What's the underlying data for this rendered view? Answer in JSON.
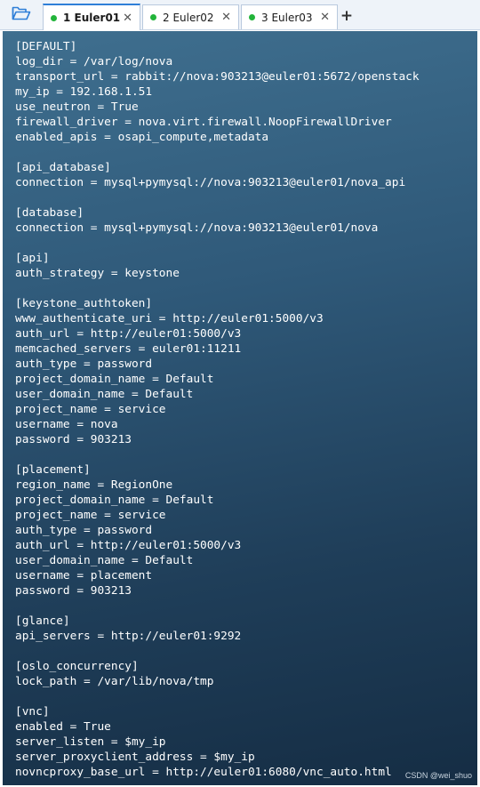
{
  "toolbar": {
    "folder_icon": "folder-open-icon"
  },
  "tabs": [
    {
      "label": "1 Euler01",
      "active": true,
      "status_color": "#22b43a"
    },
    {
      "label": "2 Euler02",
      "active": false,
      "status_color": "#22b43a"
    },
    {
      "label": "3 Euler03",
      "active": false,
      "status_color": "#22b43a"
    }
  ],
  "tab_close_glyph": "✕",
  "add_tab_glyph": "+",
  "terminal": {
    "lines": [
      "[DEFAULT]",
      "log_dir = /var/log/nova",
      "transport_url = rabbit://nova:903213@euler01:5672/openstack",
      "my_ip = 192.168.1.51",
      "use_neutron = True",
      "firewall_driver = nova.virt.firewall.NoopFirewallDriver",
      "enabled_apis = osapi_compute,metadata",
      "",
      "[api_database]",
      "connection = mysql+pymysql://nova:903213@euler01/nova_api",
      "",
      "[database]",
      "connection = mysql+pymysql://nova:903213@euler01/nova",
      "",
      "[api]",
      "auth_strategy = keystone",
      "",
      "[keystone_authtoken]",
      "www_authenticate_uri = http://euler01:5000/v3",
      "auth_url = http://euler01:5000/v3",
      "memcached_servers = euler01:11211",
      "auth_type = password",
      "project_domain_name = Default",
      "user_domain_name = Default",
      "project_name = service",
      "username = nova",
      "password = 903213",
      "",
      "[placement]",
      "region_name = RegionOne",
      "project_domain_name = Default",
      "project_name = service",
      "auth_type = password",
      "auth_url = http://euler01:5000/v3",
      "user_domain_name = Default",
      "username = placement",
      "password = 903213",
      "",
      "[glance]",
      "api_servers = http://euler01:9292",
      "",
      "[oslo_concurrency]",
      "lock_path = /var/lib/nova/tmp",
      "",
      "[vnc]",
      "enabled = True",
      "server_listen = $my_ip",
      "server_proxyclient_address = $my_ip",
      "novncproxy_base_url = http://euler01:6080/vnc_auto.html"
    ]
  },
  "watermark": "CSDN @wei_shuo"
}
